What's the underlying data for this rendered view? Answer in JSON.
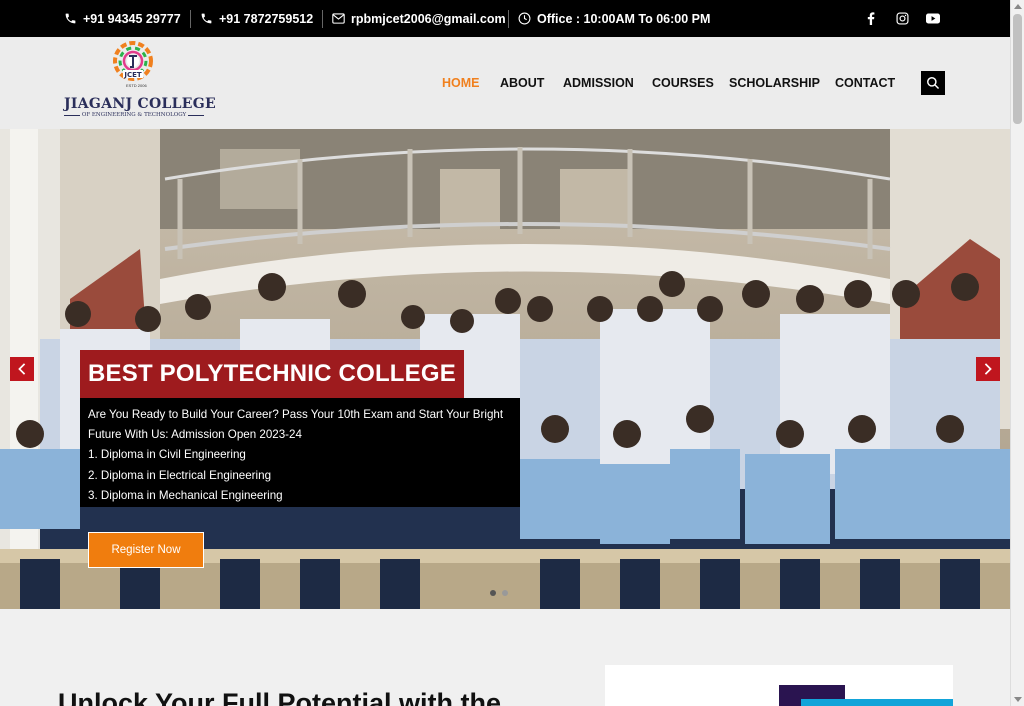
{
  "topbar": {
    "phone1": "+91 94345 29777",
    "phone2": "+91 7872759512",
    "email": "rpbmjcet2006@gmail.com",
    "office": "Office : 10:00AM To 06:00 PM",
    "social": [
      "facebook-icon",
      "instagram-icon",
      "youtube-icon"
    ]
  },
  "logo": {
    "emblem_text": "JCET",
    "estd": "ESTD 2006",
    "name": "JIAGANJ COLLEGE",
    "tagline": "OF ENGINEERING & TECHNOLOGY"
  },
  "nav": {
    "items": [
      "HOME",
      "ABOUT",
      "ADMISSION",
      "COURSES",
      "SCHOLARSHIP",
      "CONTACT"
    ],
    "active": "HOME"
  },
  "hero": {
    "headline": "BEST POLYTECHNIC COLLEGE",
    "lines": [
      "Are You Ready to Build Your Career? Pass Your 10th Exam and Start Your Bright",
      "Future With Us: Admission Open 2023-24",
      "1. Diploma in Civil Engineering",
      "2. Diploma in Electrical Engineering",
      "3. Diploma in Mechanical Engineering"
    ],
    "cta": "Register Now"
  },
  "section": {
    "title": "Unlock Your Full Potential with the"
  },
  "colors": {
    "accent": "#f07d0e",
    "headline_bg": "#9e1b1e",
    "arrow_bg": "#c0161e",
    "brand_navy": "#2a2e5a"
  }
}
